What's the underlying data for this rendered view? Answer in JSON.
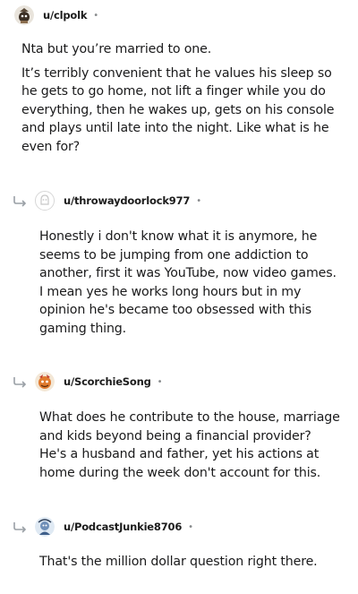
{
  "comments": [
    {
      "username": "u/clpolk",
      "separator": "•",
      "paragraphs": [
        "Nta but you’re married to one.",
        "It’s terribly convenient that he values his sleep so he gets to go home, not lift a finger while you do everything, then he wakes up, gets on his console and plays until late into the night. Like what is he even for?"
      ]
    },
    {
      "username": "u/throwaydoorlock977",
      "separator": "•",
      "paragraphs": [
        "Honestly i don't know what it is anymore, he seems to be jumping from one addiction to another, first it was YouTube, now video games. I mean yes he works long hours but in my opinion he's became too obsessed with this gaming thing."
      ]
    },
    {
      "username": "u/ScorchieSong",
      "separator": "•",
      "paragraphs": [
        "What does he contribute to the house, marriage and kids beyond being a financial provider? He's a husband and father, yet his actions at home during the week don't account for this."
      ]
    },
    {
      "username": "u/PodcastJunkie8706",
      "separator": "•",
      "paragraphs": [
        "That's the million dollar question right there."
      ]
    }
  ]
}
